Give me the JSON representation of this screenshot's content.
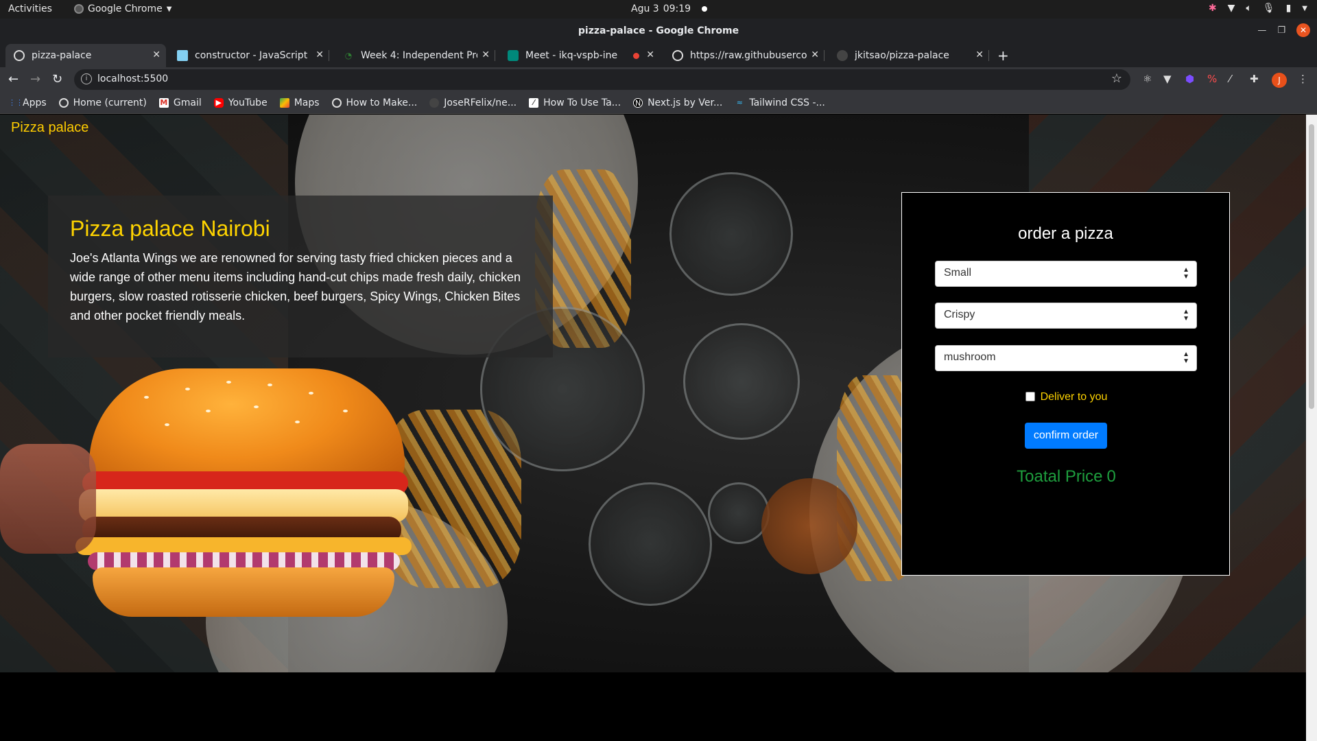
{
  "os": {
    "activities": "Activities",
    "app_name": "Google Chrome",
    "date": "Agu 3",
    "time": "09:19"
  },
  "window": {
    "title": "pizza-palace - Google Chrome"
  },
  "tabs": [
    {
      "label": "pizza-palace",
      "icon": "globe-icon"
    },
    {
      "label": "constructor - JavaScript |",
      "icon": "mdn-icon"
    },
    {
      "label": "Week 4: Independent Proj",
      "icon": "moringa-icon"
    },
    {
      "label": "Meet - ikq-vspb-ine",
      "icon": "meet-icon"
    },
    {
      "label": "https://raw.githubuserco",
      "icon": "globe-icon"
    },
    {
      "label": "jkitsao/pizza-palace",
      "icon": "github-icon"
    }
  ],
  "toolbar": {
    "url": "localhost:5500"
  },
  "bookmarks": [
    {
      "label": "Apps",
      "icon": "apps-grid-icon"
    },
    {
      "label": "Home (current)",
      "icon": "globe-icon"
    },
    {
      "label": "Gmail",
      "icon": "gmail-icon"
    },
    {
      "label": "YouTube",
      "icon": "youtube-icon"
    },
    {
      "label": "Maps",
      "icon": "maps-icon"
    },
    {
      "label": "How to Make...",
      "icon": "globe-icon"
    },
    {
      "label": "JoseRFelix/ne...",
      "icon": "github-icon"
    },
    {
      "label": "How To Use Ta...",
      "icon": "bookmark-icon"
    },
    {
      "label": "Next.js by Ver...",
      "icon": "nextjs-icon"
    },
    {
      "label": "Tailwind CSS -...",
      "icon": "tailwind-icon"
    }
  ],
  "page": {
    "brand": "Pizza palace",
    "intro": {
      "title": "Pizza palace Nairobi",
      "body": "Joe's Atlanta Wings we are renowned for serving tasty fried chicken pieces and a wide range of other menu items including hand-cut chips made fresh daily, chicken burgers, slow roasted rotisserie chicken, beef burgers, Spicy Wings, Chicken Bites and other pocket friendly meals."
    },
    "order": {
      "heading": "order a pizza",
      "size": "Small",
      "crust": "Crispy",
      "topping": "mushroom",
      "deliver_label": "Deliver to you",
      "deliver_checked": false,
      "confirm_label": "confirm order",
      "total_label": "Toatal Price",
      "total_value": "0"
    }
  },
  "colors": {
    "brand": "#ffcc00",
    "title": "#ffd400",
    "confirm": "#007bff",
    "total": "#1e9e3e"
  }
}
